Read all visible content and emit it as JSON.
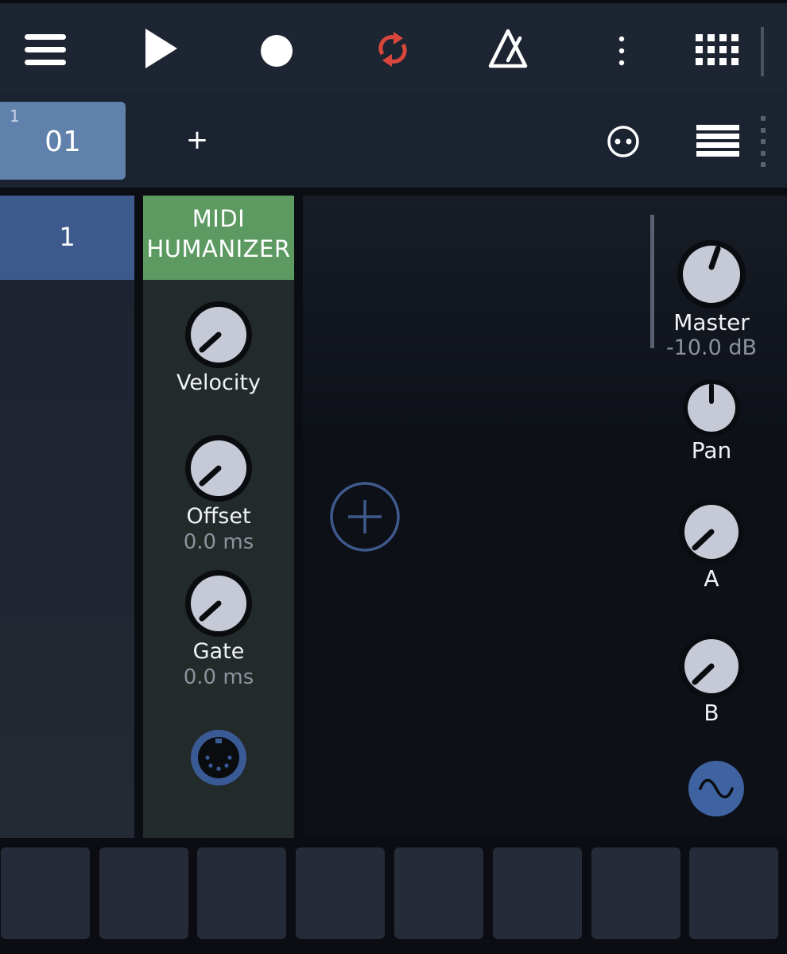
{
  "toolbar": {
    "menu_icon": "hamburger-menu-icon",
    "play_icon": "play-icon",
    "record_icon": "record-icon",
    "loop_icon": "loop-icon",
    "metronome_icon": "metronome-icon",
    "more_icon": "vertical-dots-icon",
    "grid_icon": "pad-grid-icon",
    "loop_color": "#d9473c"
  },
  "patterns": {
    "active_tab": {
      "index": "1",
      "name": "01"
    },
    "add_label": "+"
  },
  "track": {
    "label": "1"
  },
  "plugin": {
    "title_line1": "MIDI",
    "title_line2": "HUMANIZER",
    "knobs": {
      "velocity": {
        "label": "Velocity"
      },
      "offset": {
        "label": "Offset",
        "value": "0.0 ms"
      },
      "gate": {
        "label": "Gate",
        "value": "0.0 ms"
      }
    },
    "header_color": "#5c9a62"
  },
  "mixer": {
    "master": {
      "label": "Master",
      "value": "-10.0 dB"
    },
    "pan": {
      "label": "Pan"
    },
    "send_a": {
      "label": "A"
    },
    "send_b": {
      "label": "B"
    }
  },
  "colors": {
    "accent_blue": "#3e5a8c",
    "tab_blue": "#5f81ab"
  }
}
